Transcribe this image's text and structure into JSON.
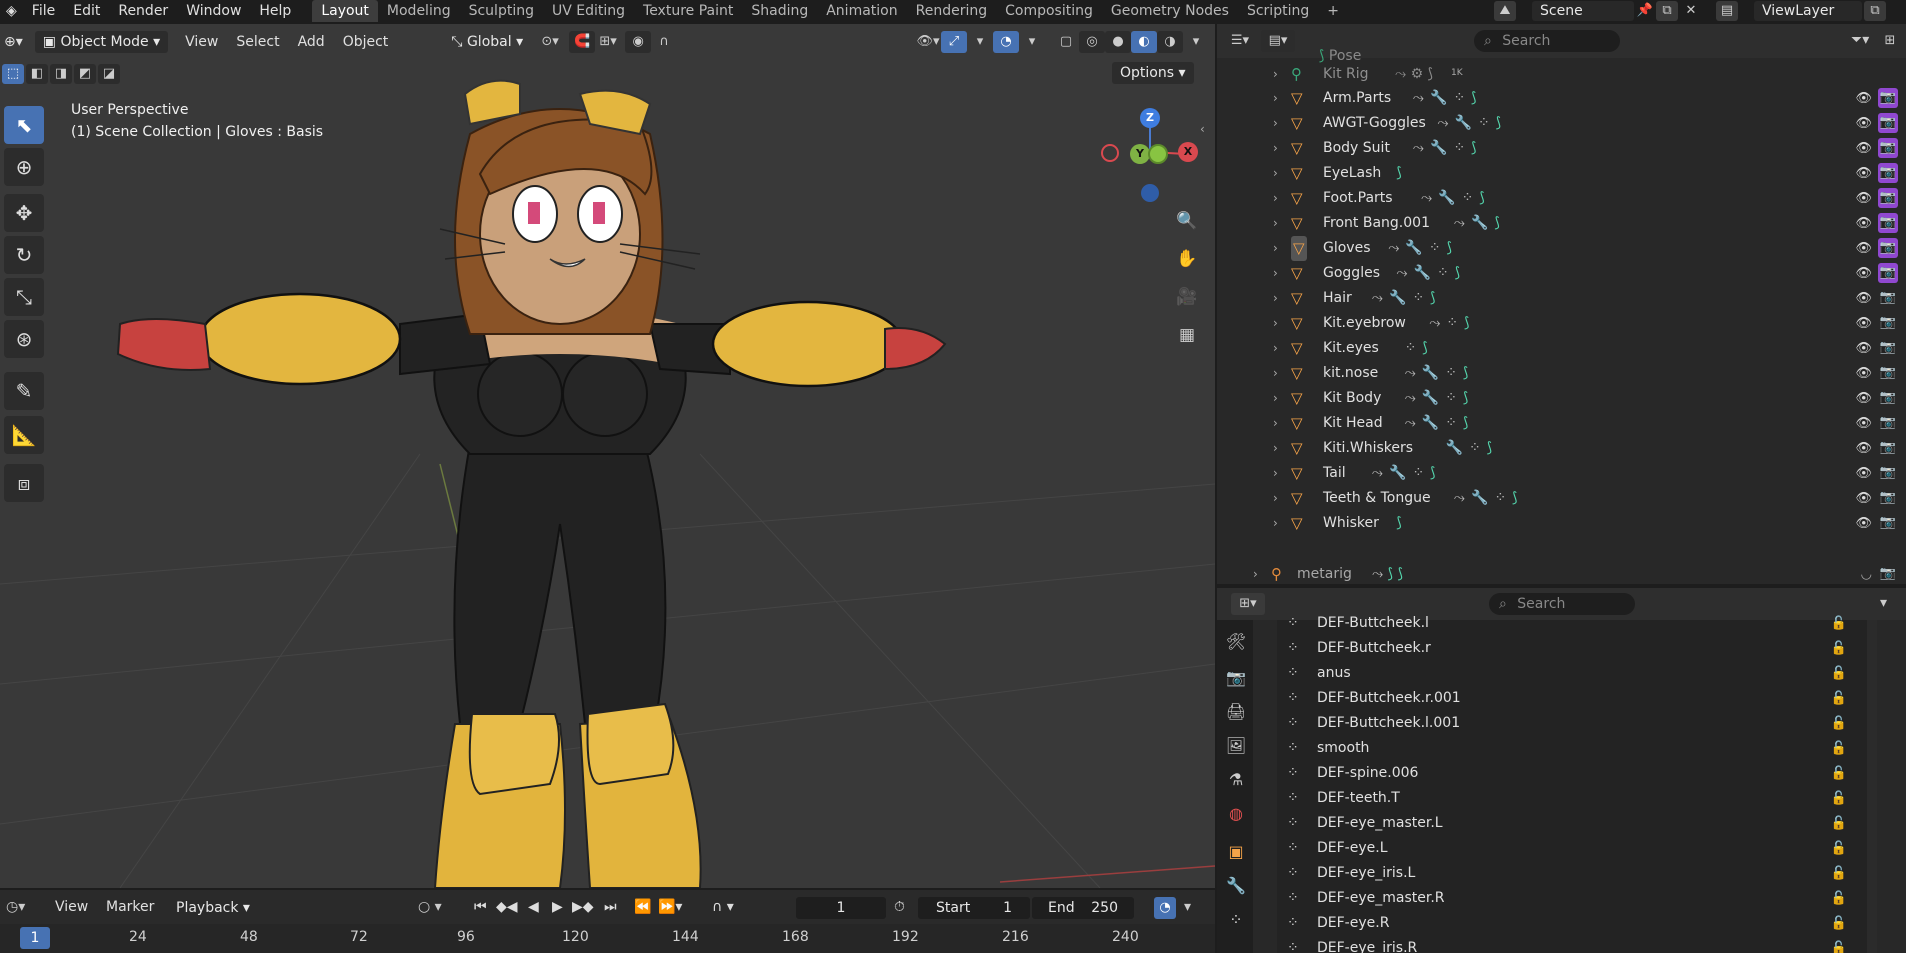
{
  "topbar": {
    "menus": [
      "File",
      "Edit",
      "Render",
      "Window",
      "Help"
    ],
    "workspaces": [
      "Layout",
      "Modeling",
      "Sculpting",
      "UV Editing",
      "Texture Paint",
      "Shading",
      "Animation",
      "Rendering",
      "Compositing",
      "Geometry Nodes",
      "Scripting"
    ],
    "active_workspace": "Layout",
    "scene": "Scene",
    "view_layer": "ViewLayer"
  },
  "viewport": {
    "mode": "Object Mode",
    "menus": [
      "View",
      "Select",
      "Add",
      "Object"
    ],
    "orientation": "Global",
    "options_label": "Options",
    "overlay_line1": "User Perspective",
    "overlay_line2": "(1) Scene Collection | Gloves : Basis",
    "gizmo": {
      "z": "Z",
      "y": "Y",
      "x": "X"
    }
  },
  "outliner": {
    "search_placeholder": "Search",
    "partial_top": "Pose",
    "kit_rig": {
      "label": "Kit Rig",
      "badge": "1K"
    },
    "objects": [
      {
        "label": "Arm.Parts",
        "mods": "cwvd",
        "cam_on": true
      },
      {
        "label": "AWGT-Goggles",
        "mods": "cwvd",
        "cam_on": true
      },
      {
        "label": "Body Suit",
        "mods": "cwvd",
        "cam_on": true
      },
      {
        "label": "EyeLash",
        "mods": "d",
        "cam_on": true
      },
      {
        "label": "Foot.Parts",
        "mods": "cwvd",
        "cam_on": true
      },
      {
        "label": "Front Bang.001",
        "mods": "cwd",
        "cam_on": true
      },
      {
        "label": "Gloves",
        "mods": "cwvd",
        "cam_on": true
      },
      {
        "label": "Goggles",
        "mods": "cwvd",
        "cam_on": true
      },
      {
        "label": "Hair",
        "mods": "cwvd",
        "cam_on": false
      },
      {
        "label": "Kit.eyebrow",
        "mods": "cvd",
        "cam_on": false
      },
      {
        "label": "Kit.eyes",
        "mods": "vd",
        "cam_on": false
      },
      {
        "label": "kit.nose",
        "mods": "cwvd",
        "cam_on": false
      },
      {
        "label": "Kit Body",
        "mods": "cwvd",
        "cam_on": false
      },
      {
        "label": "Kit Head",
        "mods": "cwvd",
        "cam_on": false
      },
      {
        "label": "Kiti.Whiskers",
        "mods": "wvd",
        "cam_on": false
      },
      {
        "label": "Tail",
        "mods": "cwvd",
        "cam_on": false
      },
      {
        "label": "Teeth & Tongue",
        "mods": "cwvd",
        "cam_on": false
      },
      {
        "label": "Whisker",
        "mods": "d",
        "cam_on": false
      }
    ],
    "metarig": "metarig"
  },
  "properties": {
    "search_placeholder": "Search",
    "vertex_groups": [
      "DEF-Buttcheek.l",
      "DEF-Buttcheek.r",
      "anus",
      "DEF-Buttcheek.r.001",
      "DEF-Buttcheek.l.001",
      "smooth",
      "DEF-spine.006",
      "DEF-teeth.T",
      "DEF-eye_master.L",
      "DEF-eye.L",
      "DEF-eye_iris.L",
      "DEF-eye_master.R",
      "DEF-eye.R",
      "DEF-eye_iris.R"
    ]
  },
  "timeline": {
    "menus": [
      "View",
      "Marker",
      "Playback"
    ],
    "current_frame": "1",
    "start_label": "Start",
    "start": "1",
    "end_label": "End",
    "end": "250",
    "ruler": [
      "1",
      "24",
      "48",
      "72",
      "96",
      "120",
      "144",
      "168",
      "192",
      "216",
      "240"
    ]
  },
  "colors": {
    "accent": "#4772b3",
    "object_icon": "#f5a349",
    "render_toggle": "#9048d0",
    "modifier_wrench": "#6c9ef5",
    "mesh_data": "#54d6ad"
  }
}
